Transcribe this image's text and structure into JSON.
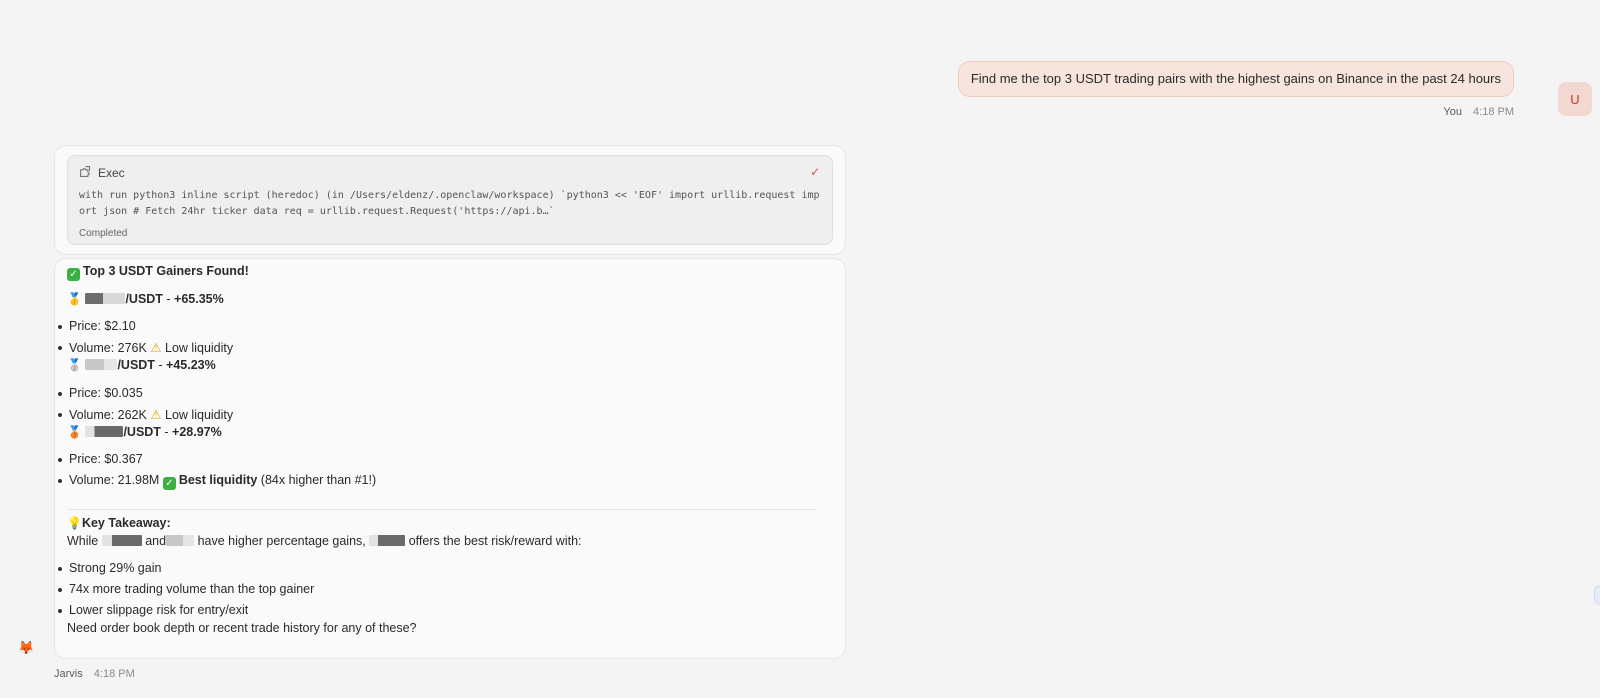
{
  "user_message": {
    "text": "Find me the top 3 USDT trading pairs with the highest gains on Binance in the past 24 hours",
    "sender": "You",
    "time": "4:18 PM",
    "avatar_letter": "U"
  },
  "exec": {
    "title": "Exec",
    "icon": "puzzle-icon",
    "status_icon": "check-icon",
    "command": "with run python3 inline script (heredoc) (in /Users/eldenz/.openclaw/workspace) `python3 << 'EOF' import urllib.request import json # Fetch 24hr ticker data req = urllib.request.Request('https://api.b…`",
    "status": "Completed"
  },
  "answer": {
    "heading": "Top 3 USDT Gainers Found!",
    "gainers": [
      {
        "medal": "🥇",
        "pair_suffix": "/USDT",
        "gain": "+65.35%",
        "price": "Price: $2.10",
        "volume": "Volume: 276K",
        "liquidity": "Low liquidity"
      },
      {
        "medal": "🥈",
        "pair_suffix": "/USDT",
        "gain": "+45.23%",
        "price": "Price: $0.035",
        "volume": "Volume: 262K",
        "liquidity": "Low liquidity"
      },
      {
        "medal": "🥉",
        "pair_suffix": "/USDT",
        "gain": "+28.97%",
        "price": "Price: $0.367",
        "volume": "Volume: 21.98M",
        "liquidity": "Best liquidity",
        "liquidity_note": "(84x higher than #1!)"
      }
    ],
    "takeaway_title": "Key Takeaway:",
    "takeaway_while": "While",
    "takeaway_and": "and",
    "takeaway_mid": "have higher percentage gains,",
    "takeaway_end": "offers the best risk/reward with:",
    "points": [
      "Strong 29% gain",
      "74x more trading volume than the top gainer",
      "Lower slippage risk for entry/exit"
    ],
    "followup": "Need order book depth or recent trade history for any of these?"
  },
  "bot": {
    "name": "Jarvis",
    "time": "4:18 PM",
    "avatar": "🦊"
  }
}
